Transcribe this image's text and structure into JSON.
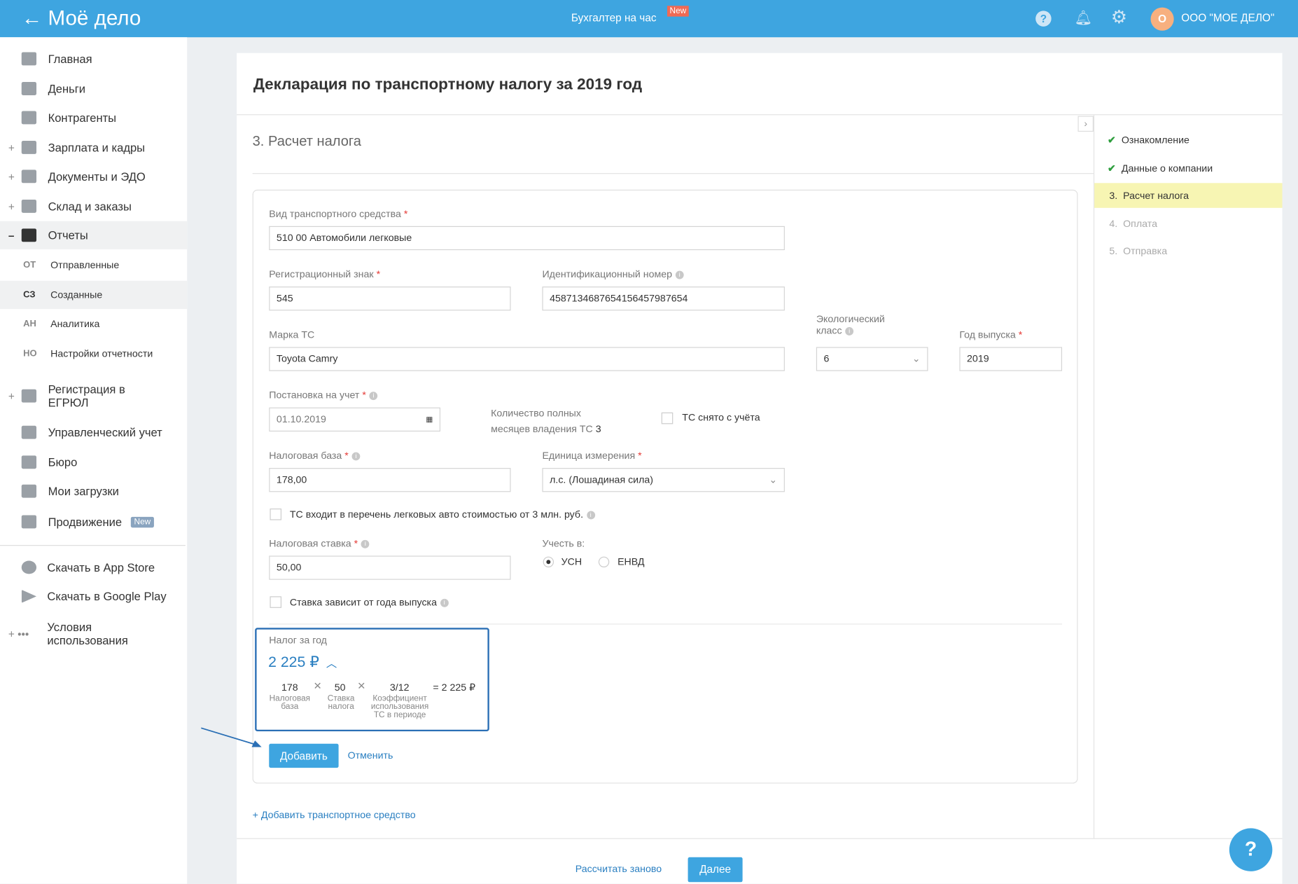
{
  "header": {
    "logo": "Моё дело",
    "center_link": "Бухгалтер на час",
    "new_badge": "New",
    "company": "ООО \"МОЕ ДЕЛО\"",
    "avatar_letter": "О"
  },
  "sidebar": {
    "items": [
      {
        "label": "Главная"
      },
      {
        "label": "Деньги"
      },
      {
        "label": "Контрагенты"
      },
      {
        "label": "Зарплата и кадры"
      },
      {
        "label": "Документы и ЭДО"
      },
      {
        "label": "Склад и заказы"
      },
      {
        "label": "Отчеты"
      }
    ],
    "sub": [
      {
        "abbr": "ОТ",
        "label": "Отправленные"
      },
      {
        "abbr": "СЗ",
        "label": "Созданные"
      },
      {
        "abbr": "АН",
        "label": "Аналитика"
      },
      {
        "abbr": "НО",
        "label": "Настройки отчетности"
      }
    ],
    "items2": [
      {
        "label": "Регистрация в ЕГРЮЛ"
      },
      {
        "label": "Управленческий учет"
      },
      {
        "label": "Бюро"
      },
      {
        "label": "Мои загрузки"
      },
      {
        "label": "Продвижение",
        "badge": "New"
      }
    ],
    "bottom": [
      {
        "label": "Скачать в App Store"
      },
      {
        "label": "Скачать в Google Play"
      },
      {
        "label": "Условия использования"
      }
    ]
  },
  "page": {
    "title": "Декларация по транспортному налогу за 2019 год",
    "section": "3. Расчет налога"
  },
  "steps": [
    {
      "label": "Ознакомление",
      "status": "done"
    },
    {
      "label": "Данные о компании",
      "status": "done"
    },
    {
      "num": "3.",
      "label": "Расчет налога",
      "status": "active"
    },
    {
      "num": "4.",
      "label": "Оплата",
      "status": "pending"
    },
    {
      "num": "5.",
      "label": "Отправка",
      "status": "pending"
    }
  ],
  "form": {
    "vehicle_type_label": "Вид транспортного средства",
    "vehicle_type": "510 00 Автомобили легковые",
    "reg_label": "Регистрационный знак",
    "reg": "545",
    "vin_label": "Идентификационный номер",
    "vin": "4587134687654156457987654",
    "brand_label": "Марка ТС",
    "brand": "Toyota Camry",
    "eco_label_1": "Экологический",
    "eco_label_2": "класс",
    "eco": "6",
    "year_label": "Год выпуска",
    "year": "2019",
    "reg_date_label": "Постановка на учет",
    "reg_date": "01.10.2019",
    "months_label_1": "Количество полных",
    "months_label_2": "месяцев владения ТС",
    "months": "3",
    "removed_label": "ТС снято с учёта",
    "base_label": "Налоговая база",
    "base": "178,00",
    "unit_label": "Единица измерения",
    "unit": "л.с. (Лошадиная сила)",
    "luxury_label": "ТС входит в перечень легковых авто стоимостью от 3 млн. руб.",
    "rate_label": "Налоговая ставка",
    "rate": "50,00",
    "account_label": "Учесть в:",
    "opt_usn": "УСН",
    "opt_envd": "ЕНВД",
    "rate_year_label": "Ставка зависит от года выпуска"
  },
  "tax": {
    "label": "Налог за год",
    "total": "2 225 ₽",
    "base": "178",
    "base_l1": "Налоговая",
    "base_l2": "база",
    "rate": "50",
    "rate_l1": "Ставка",
    "rate_l2": "налога",
    "coef": "3/12",
    "coef_l1": "Коэффициент",
    "coef_l2": "использования",
    "coef_l3": "ТС в периоде",
    "result": "= 2 225 ₽",
    "times": "×"
  },
  "actions": {
    "add": "Добавить",
    "cancel": "Отменить",
    "add_vehicle": "+ Добавить транспортное средство",
    "recalc": "Рассчитать заново",
    "next": "Далее"
  },
  "colors": {
    "brand": "#3ea5e0",
    "active_step": "#f7f5b3",
    "check": "#2e9e3e",
    "focus": "#2a6fb5"
  }
}
